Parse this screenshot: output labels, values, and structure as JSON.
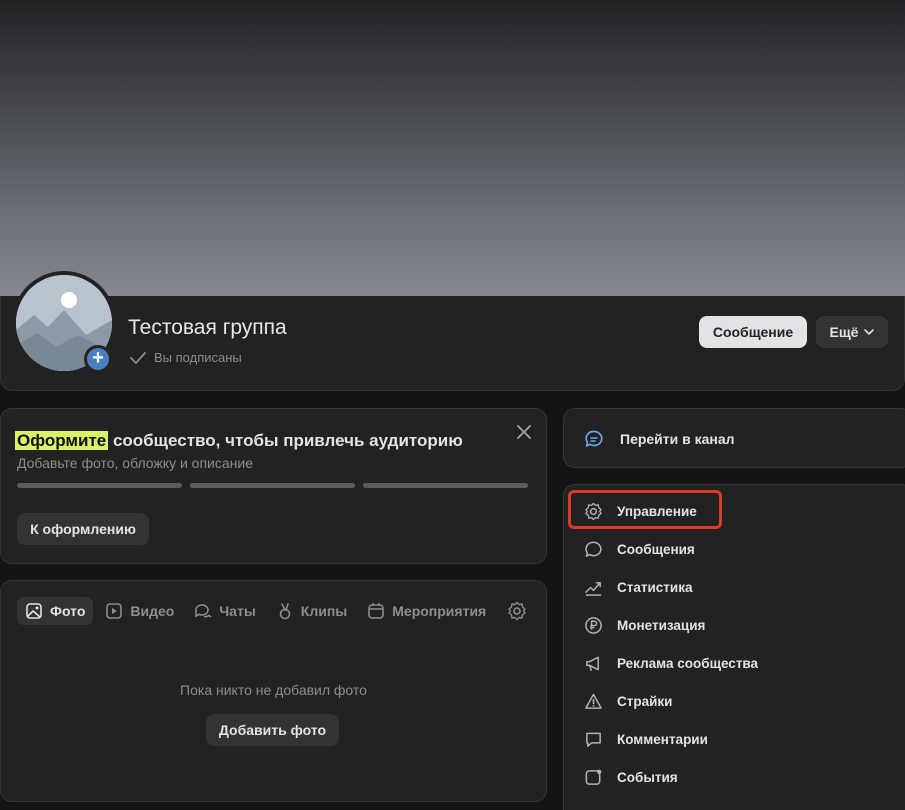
{
  "group": {
    "name": "Тестовая группа",
    "subscribed_status": "Вы подписаны",
    "message_button": "Сообщение",
    "more_button": "Ещё"
  },
  "promo": {
    "title_highlight": "Оформите",
    "title_rest": " сообщество, чтобы привлечь аудиторию",
    "subtitle": "Добавьте фото, обложку и описание",
    "button": "К оформлению",
    "progress_steps": 3
  },
  "media": {
    "tabs": [
      {
        "label": "Фото",
        "icon": "photo-icon",
        "active": true
      },
      {
        "label": "Видео",
        "icon": "video-icon",
        "active": false
      },
      {
        "label": "Чаты",
        "icon": "chats-icon",
        "active": false
      },
      {
        "label": "Клипы",
        "icon": "clips-icon",
        "active": false
      },
      {
        "label": "Мероприятия",
        "icon": "calendar-icon",
        "active": false
      }
    ],
    "empty_text": "Пока никто не добавил фото",
    "add_button": "Добавить фото"
  },
  "channel": {
    "label": "Перейти в канал",
    "icon": "chat-bubble-icon"
  },
  "menu": {
    "items": [
      {
        "label": "Управление",
        "icon": "gear-icon"
      },
      {
        "label": "Сообщения",
        "icon": "message-icon"
      },
      {
        "label": "Статистика",
        "icon": "chart-icon"
      },
      {
        "label": "Монетизация",
        "icon": "ruble-icon"
      },
      {
        "label": "Реклама сообщества",
        "icon": "megaphone-icon"
      },
      {
        "label": "Страйки",
        "icon": "warning-icon"
      },
      {
        "label": "Комментарии",
        "icon": "comment-icon"
      },
      {
        "label": "События",
        "icon": "events-icon"
      }
    ]
  },
  "colors": {
    "accent_highlight": "#d6f36a",
    "avatar_add": "#4a7fc1",
    "annotation_box": "#e0382a"
  }
}
